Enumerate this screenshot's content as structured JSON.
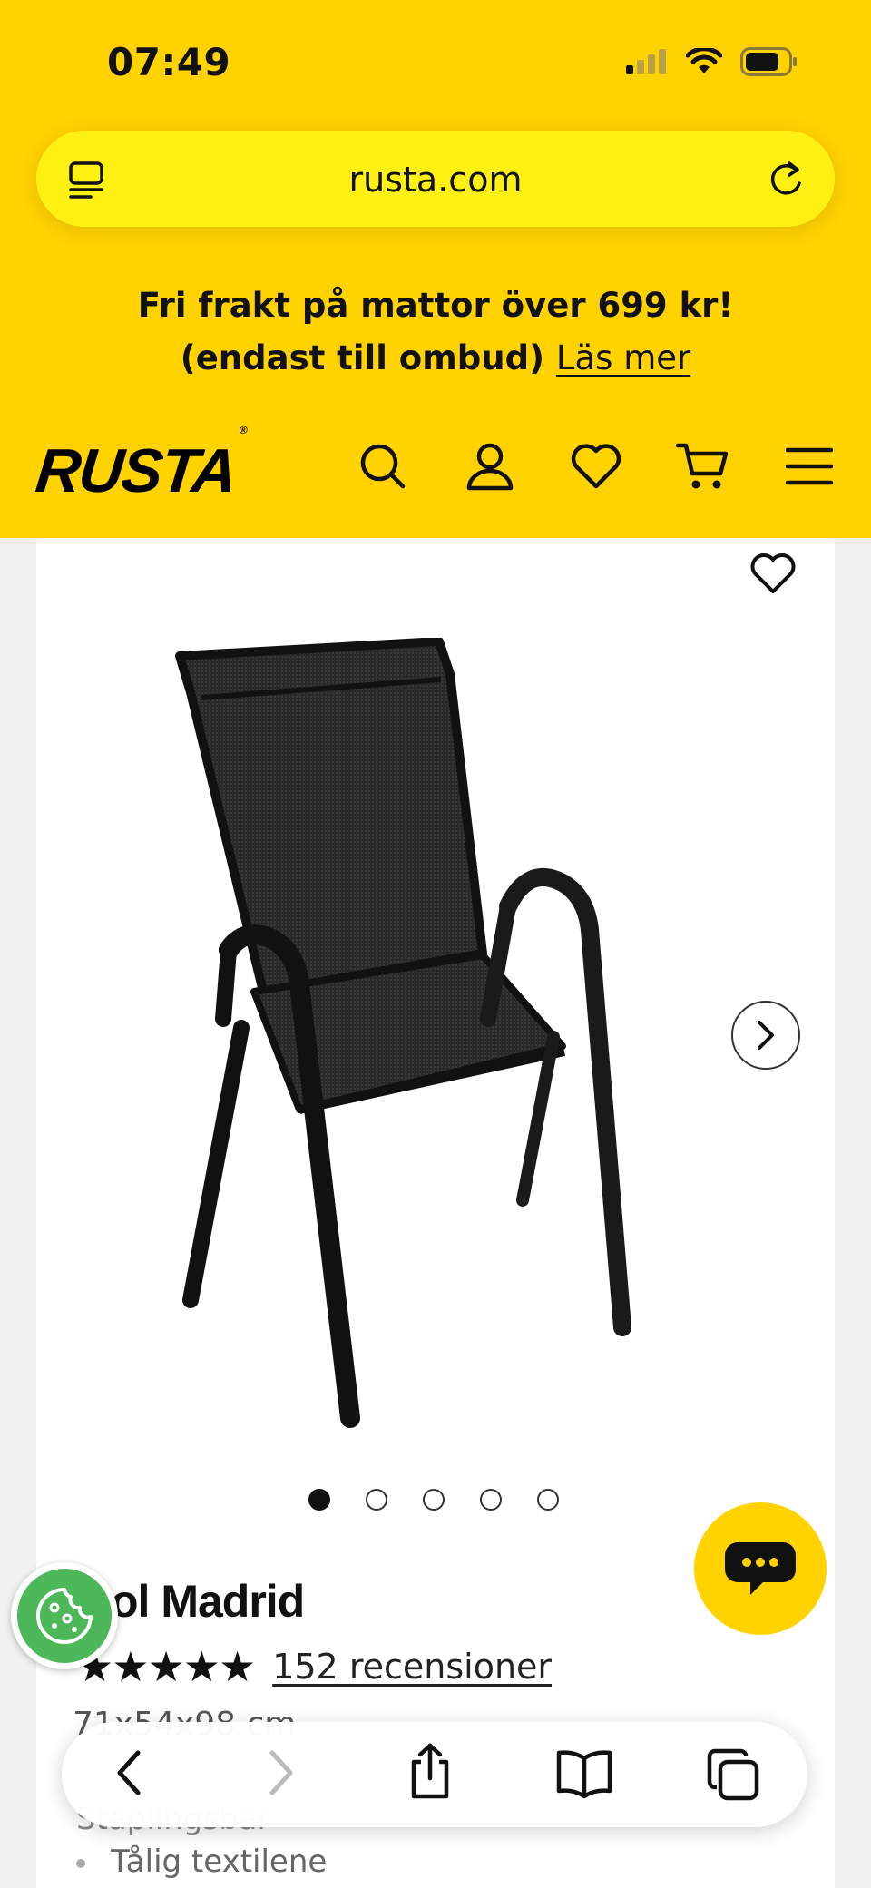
{
  "status_bar": {
    "time": "07:49"
  },
  "browser": {
    "url": "rusta.com"
  },
  "promo": {
    "text": "Fri frakt på mattor över 699 kr! (endast till ombud)",
    "link": "Läs mer"
  },
  "header": {
    "logo": "RUSTA",
    "registered_mark": "®"
  },
  "product": {
    "title": "ol Madrid",
    "rating_stars": "★★★★★",
    "reviews": "152 recensioner",
    "dims_partial": "71x54x98 cm",
    "bullet_partial": "Staplingsbar",
    "bullet_visible": "Tålig textilene"
  },
  "gallery": {
    "image_count": 5,
    "active_index": 0
  },
  "colors": {
    "brand_yellow": "#ffd200",
    "url_yellow": "#fff014",
    "cookie_green": "#4db85a"
  },
  "icons": [
    "reader-icon",
    "reload-icon",
    "search-icon",
    "account-icon",
    "heart-icon",
    "cart-icon",
    "menu-icon",
    "chevron-right-icon",
    "chat-icon",
    "cookie-icon",
    "back-icon",
    "forward-icon",
    "share-icon",
    "bookmarks-icon",
    "tabs-icon"
  ]
}
